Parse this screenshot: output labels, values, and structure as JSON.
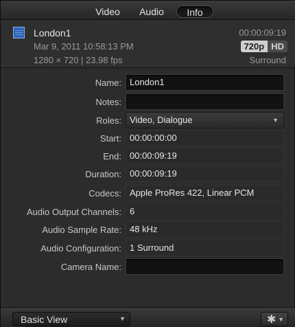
{
  "tabs": [
    {
      "label": "Video",
      "active": false
    },
    {
      "label": "Audio",
      "active": false
    },
    {
      "label": "Info",
      "active": true
    }
  ],
  "header": {
    "clip_icon": "filmstrip-icon",
    "clip_name": "London1",
    "date": "Mar 9, 2011 10:58:13 PM",
    "resolution": "1280 × 720 | 23.98 fps",
    "timecode": "00:00:09:19",
    "badge_720p": "720p",
    "badge_hd": "HD",
    "audio_config": "Surround"
  },
  "fields": {
    "name": {
      "label": "Name:",
      "value": "London1"
    },
    "notes": {
      "label": "Notes:",
      "value": ""
    },
    "roles": {
      "label": "Roles:",
      "value": "Video, Dialogue"
    },
    "start": {
      "label": "Start:",
      "value": "00:00:00:00"
    },
    "end": {
      "label": "End:",
      "value": "00:00:09:19"
    },
    "duration": {
      "label": "Duration:",
      "value": "00:00:09:19"
    },
    "codecs": {
      "label": "Codecs:",
      "value": "Apple ProRes 422, Linear PCM"
    },
    "audio_output_channels": {
      "label": "Audio Output Channels:",
      "value": "6"
    },
    "audio_sample_rate": {
      "label": "Audio Sample Rate:",
      "value": "48 kHz"
    },
    "audio_configuration": {
      "label": "Audio Configuration:",
      "value": "1 Surround"
    },
    "camera_name": {
      "label": "Camera Name:",
      "value": ""
    }
  },
  "bottom": {
    "view_select": "Basic View",
    "action_icon": "gear-icon"
  },
  "colors": {
    "background": "#2c2c2c",
    "field_bg": "#121212",
    "badge_light": "#cfcfcf",
    "clip_icon_blue": "#2d64b8"
  }
}
